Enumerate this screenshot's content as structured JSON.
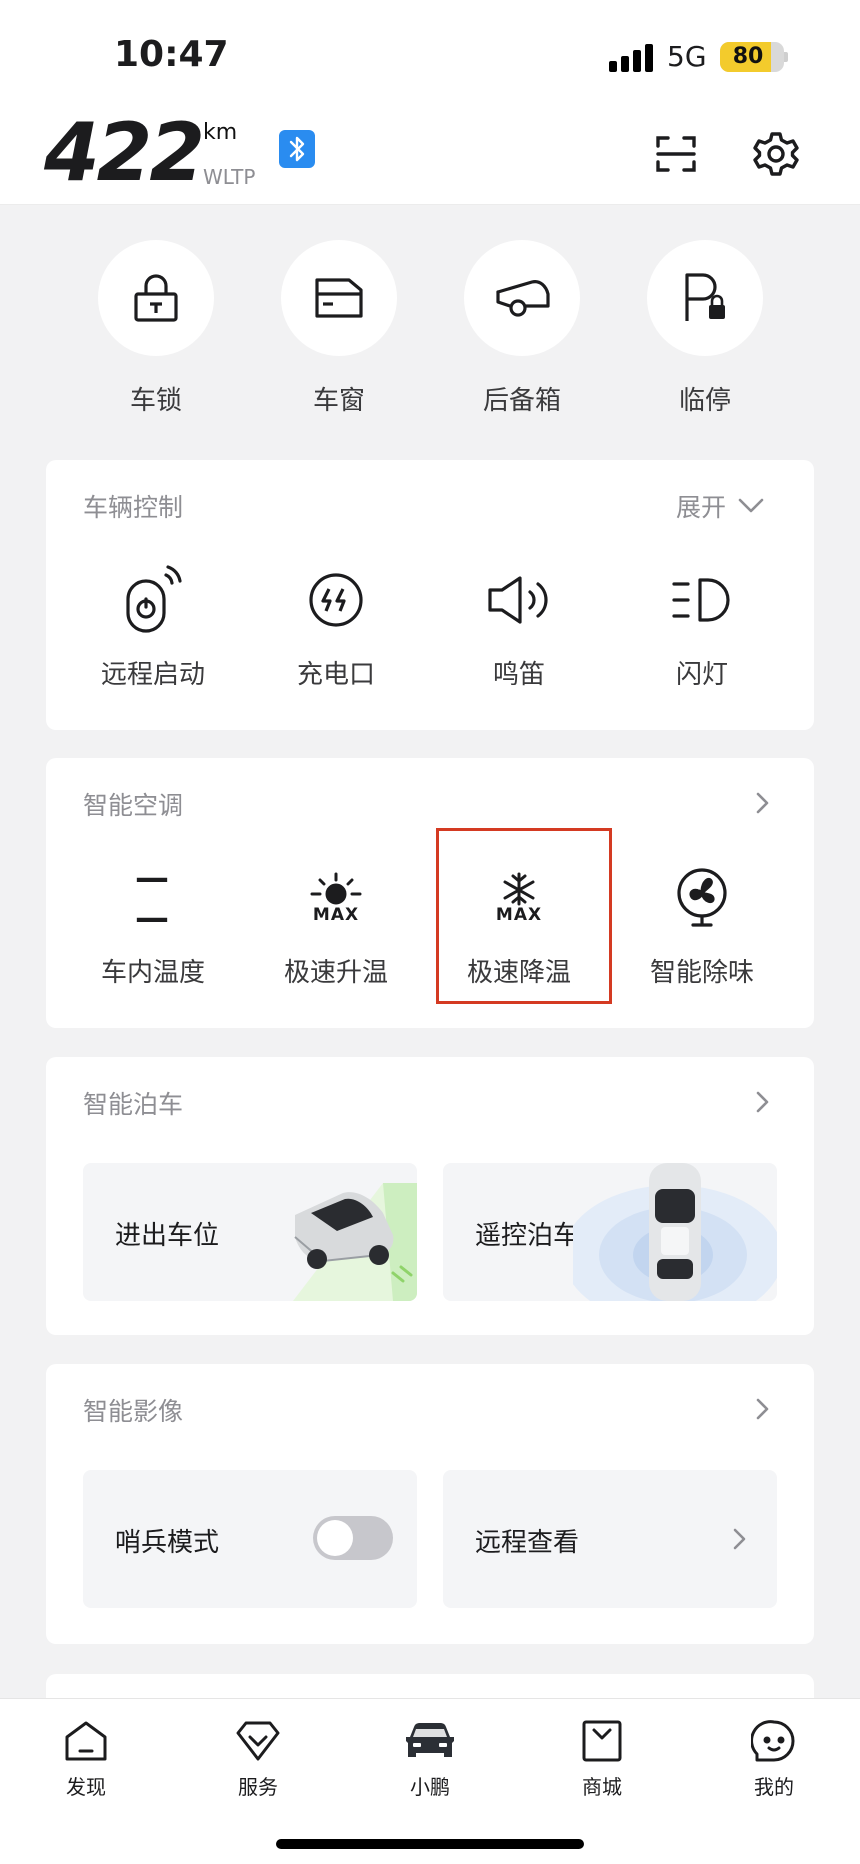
{
  "status": {
    "time": "10:47",
    "network": "5G",
    "battery": "80",
    "battery_level": 0.8
  },
  "header": {
    "range_value": "422",
    "range_unit": "km",
    "range_standard": "WLTP"
  },
  "quick_actions": [
    {
      "label": "车锁",
      "icon": "lock-icon"
    },
    {
      "label": "车窗",
      "icon": "window-icon"
    },
    {
      "label": "后备箱",
      "icon": "trunk-icon"
    },
    {
      "label": "临停",
      "icon": "parking-lock-icon"
    }
  ],
  "vehicle_control": {
    "title": "车辆控制",
    "expand_label": "展开",
    "items": [
      {
        "label": "远程启动",
        "icon": "remote-start-icon"
      },
      {
        "label": "充电口",
        "icon": "charge-port-icon"
      },
      {
        "label": "鸣笛",
        "icon": "horn-icon"
      },
      {
        "label": "闪灯",
        "icon": "flash-lights-icon"
      }
    ]
  },
  "climate": {
    "title": "智能空调",
    "cabin_temp_value": "— —",
    "max_label": "MAX",
    "items": [
      {
        "label": "车内温度",
        "icon": "cabin-temperature-icon"
      },
      {
        "label": "极速升温",
        "icon": "max-heat-icon"
      },
      {
        "label": "极速降温",
        "icon": "max-cool-icon"
      },
      {
        "label": "智能除味",
        "icon": "fan-icon"
      }
    ]
  },
  "parking": {
    "title": "智能泊车",
    "tiles": [
      {
        "label": "进出车位"
      },
      {
        "label": "遥控泊车"
      }
    ]
  },
  "imaging": {
    "title": "智能影像",
    "sentry_label": "哨兵模式",
    "sentry_on": false,
    "remote_view_label": "远程查看"
  },
  "tabbar": [
    {
      "label": "发现",
      "icon": "discover-icon"
    },
    {
      "label": "服务",
      "icon": "service-icon"
    },
    {
      "label": "小鹏",
      "icon": "car-icon"
    },
    {
      "label": "商城",
      "icon": "store-icon"
    },
    {
      "label": "我的",
      "icon": "profile-icon"
    }
  ],
  "colors": {
    "accent_battery": "#f3cb2c",
    "bluetooth": "#2a8cf0",
    "highlight_box": "#d43a22"
  }
}
